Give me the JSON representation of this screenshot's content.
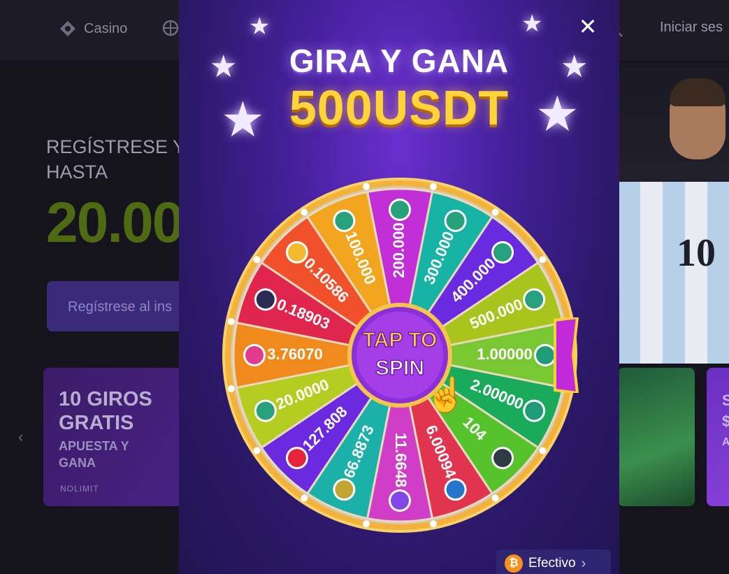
{
  "nav": {
    "casino_label": "Casino",
    "login_label": "Iniciar ses"
  },
  "hero": {
    "line1": "REGÍSTRESE Y",
    "line2": "HASTA",
    "amount": "20.00",
    "register_label": "Regístrese al ins"
  },
  "promo": {
    "title1": "10 GIROS",
    "title2": "GRATIS",
    "sub1": "APUESTA Y",
    "sub2": "GANA",
    "brand": "NOLIMIT"
  },
  "game_card2": {
    "line1": "S",
    "line2": "$",
    "line3": "A"
  },
  "player": {
    "number": "10"
  },
  "modal": {
    "title1": "GIRA Y GANA",
    "title2": "500USDT",
    "center_line1": "TAP TO",
    "center_line2": "SPIN",
    "cash_label": "Efectivo",
    "close_glyph": "✕"
  },
  "wheel": {
    "segments": [
      {
        "value": "200.000",
        "color": "#c22fd6",
        "icon": "tether-icon",
        "icon_color": "#26a17b"
      },
      {
        "value": "300.000",
        "color": "#17b3a5",
        "icon": "tether-icon",
        "icon_color": "#26a17b"
      },
      {
        "value": "400.000",
        "color": "#6a2be0",
        "icon": "tether-icon",
        "icon_color": "#26a17b"
      },
      {
        "value": "500.000",
        "color": "#a9c41c",
        "icon": "tether-icon",
        "icon_color": "#26a17b"
      },
      {
        "value": "1.00000",
        "color": "#79c733",
        "icon": "bitcoin-cash-icon",
        "icon_color": "#1f9b78"
      },
      {
        "value": "2.00000",
        "color": "#1aaa5b",
        "icon": "bitcoin-cash-icon",
        "icon_color": "#1f9b78"
      },
      {
        "value": "104",
        "color": "#55c22b",
        "icon": "xrp-icon",
        "icon_color": "#303a44"
      },
      {
        "value": "6.00094",
        "color": "#e0344f",
        "icon": "usdc-icon",
        "icon_color": "#2775ca"
      },
      {
        "value": "11.6648",
        "color": "#d03ec8",
        "icon": "polygon-icon",
        "icon_color": "#8247e5"
      },
      {
        "value": "66.8873",
        "color": "#1bb0a8",
        "icon": "dogecoin-icon",
        "icon_color": "#c2a633"
      },
      {
        "value": "127.808",
        "color": "#6b2ae0",
        "icon": "tron-icon",
        "icon_color": "#e5233b"
      },
      {
        "value": "20.0000",
        "color": "#b4cd20",
        "icon": "tether-icon",
        "icon_color": "#26a17b"
      },
      {
        "value": "3.76070",
        "color": "#f08a1c",
        "icon": "power-icon",
        "icon_color": "#e23a8b"
      },
      {
        "value": "0.18903",
        "color": "#e1264d",
        "icon": "solana-icon",
        "icon_color": "#2b2b55"
      },
      {
        "value": "0.10586",
        "color": "#f0502a",
        "icon": "bnb-icon",
        "icon_color": "#f3ba2f"
      },
      {
        "value": "100.000",
        "color": "#f2a51e",
        "icon": "tether-icon",
        "icon_color": "#26a17b"
      }
    ]
  }
}
